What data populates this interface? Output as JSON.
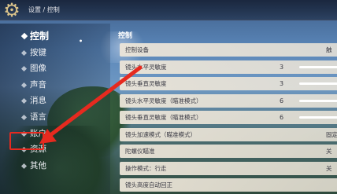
{
  "topbar": {
    "breadcrumb": "设置 / 控制",
    "icon": "gear-icon"
  },
  "sidebar": {
    "items": [
      {
        "label": "控制",
        "active": true
      },
      {
        "label": "按键"
      },
      {
        "label": "图像"
      },
      {
        "label": "声音"
      },
      {
        "label": "消息"
      },
      {
        "label": "语言"
      },
      {
        "label": "账户",
        "highlighted": true
      },
      {
        "label": "资源"
      },
      {
        "label": "其他"
      }
    ]
  },
  "panel": {
    "title": "控制",
    "rows": [
      {
        "label": "控制设备",
        "value": "",
        "right": "触"
      },
      {
        "label": "镜头水平灵敏度",
        "value": "3",
        "right": ""
      },
      {
        "label": "镜头垂直灵敏度",
        "value": "3",
        "right": ""
      },
      {
        "label": "镜头水平灵敏度（瞄准模式）",
        "value": "6",
        "right": ""
      },
      {
        "label": "镜头垂直灵敏度（瞄准模式）",
        "value": "6",
        "right": ""
      },
      {
        "label": "镜头加速模式（瞄准模式）",
        "value": "",
        "right": "固定"
      },
      {
        "label": "陀螺仪瞄准",
        "value": "",
        "right": "关"
      },
      {
        "label": "操作模式：行走",
        "value": "",
        "right": "关"
      },
      {
        "label": "镜头高度自动回正",
        "value": "",
        "right": ""
      }
    ]
  },
  "colors": {
    "annotation_red": "#e62a1f",
    "row_bg": "#ece5d8"
  }
}
